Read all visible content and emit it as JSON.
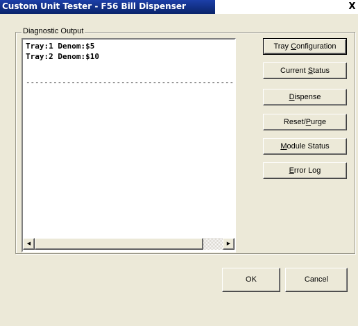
{
  "window": {
    "title": "Custom Unit Tester - F56 Bill Dispenser",
    "close_label": "X"
  },
  "diagnostic": {
    "group_label": "Diagnostic Output",
    "lines": [
      "Tray:1 Denom:$5",
      "Tray:2 Denom:$10"
    ],
    "separator": "------------------------------------------------"
  },
  "buttons": {
    "tray_configuration": {
      "pre": "Tray ",
      "accel": "C",
      "post": "onfiguration"
    },
    "current_status": {
      "pre": "Current ",
      "accel": "S",
      "post": "tatus"
    },
    "dispense": {
      "pre": "",
      "accel": "D",
      "post": "ispense"
    },
    "reset_purge": {
      "pre": "Reset/",
      "accel": "P",
      "post": "urge"
    },
    "module_status": {
      "pre": "",
      "accel": "M",
      "post": "odule Status"
    },
    "error_log": {
      "pre": "",
      "accel": "E",
      "post": "rror Log"
    },
    "ok": "OK",
    "cancel": "Cancel"
  },
  "scrollbar": {
    "left_arrow": "◀",
    "right_arrow": "▶"
  },
  "colors": {
    "titlebar": "#0a246a",
    "dialog_bg": "#ece9d8"
  }
}
